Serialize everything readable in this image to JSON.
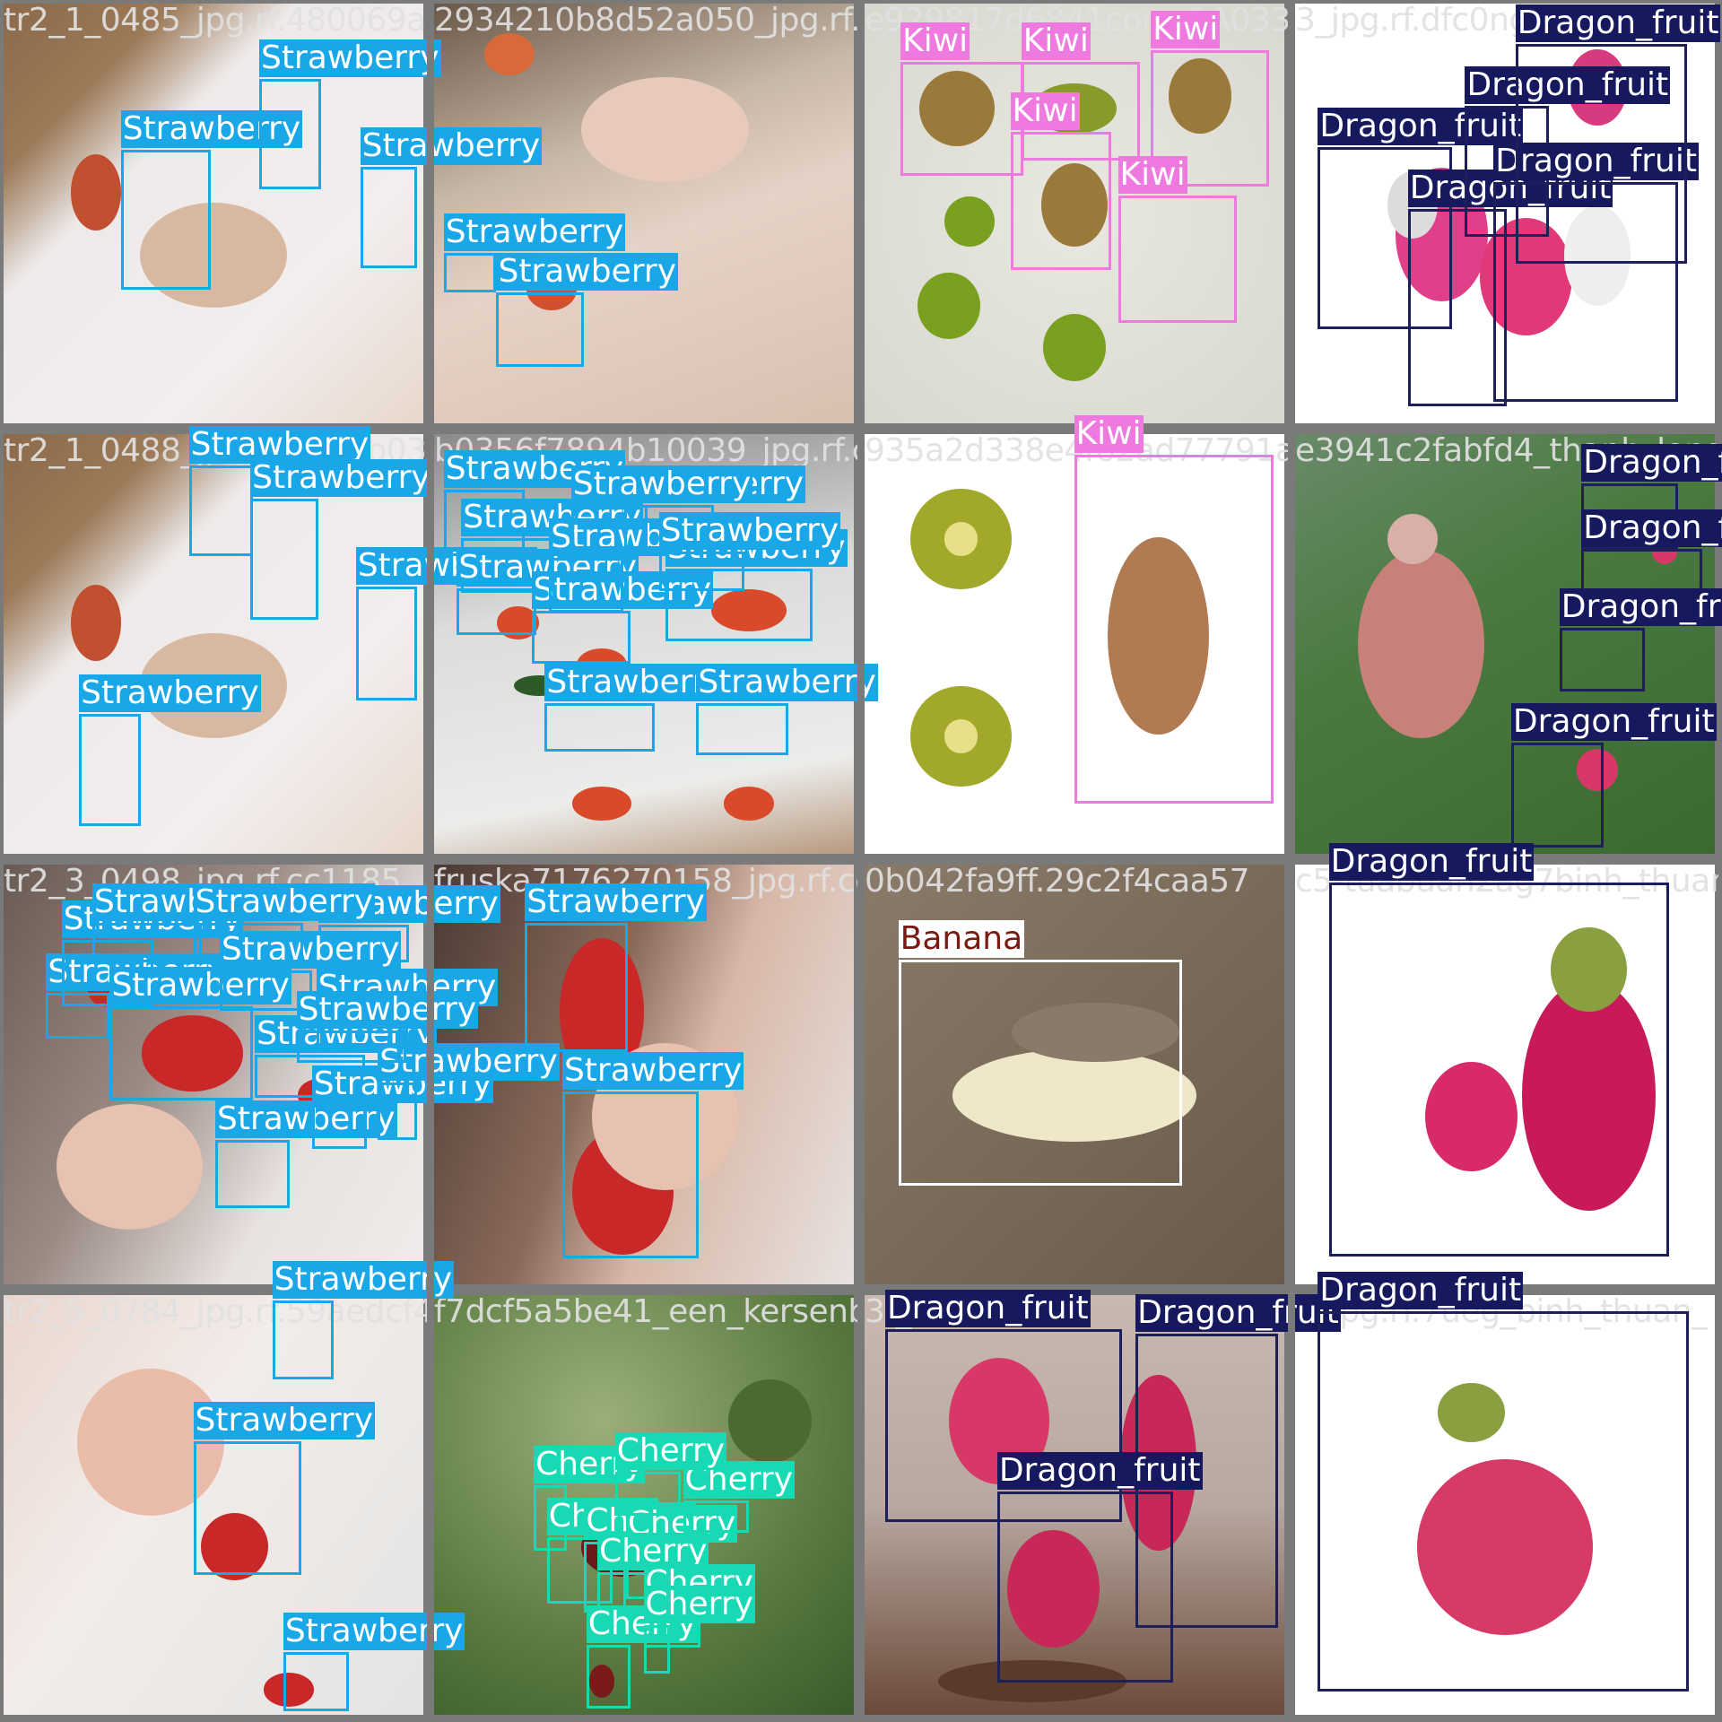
{
  "classes": {
    "Strawberry": {
      "border": "#1aa7e8",
      "bg": "#1aa7e8",
      "fg": "#ffffff"
    },
    "Kiwi": {
      "border": "#ee7ae0",
      "bg": "#ee7ae0",
      "fg": "#ffffff"
    },
    "Dragon_fruit": {
      "border": "#1c1f5a",
      "bg": "#16195e",
      "fg": "#ffffff"
    },
    "Banana": {
      "border": "#ffffff",
      "bg": "#ffffff",
      "fg": "#7a1a10"
    },
    "Cherry": {
      "border": "#17d9b4",
      "bg": "#17d9b4",
      "fg": "#ffffff"
    }
  },
  "tiles": [
    {
      "filename": "tr2_1_0485_jpg.rf.480069ac2954210b8d52a050_jpg.rf.1d4",
      "theme": "strawberry-hand",
      "detections": [
        {
          "cls": "Strawberry"
        },
        {
          "cls": "Strawberry"
        },
        {
          "cls": "Strawberry"
        }
      ]
    },
    {
      "filename": "2934210b8d52a050_jpg.rf.1d40e",
      "theme": "strawberry-hand2",
      "detections": [
        {
          "cls": "Strawberry"
        },
        {
          "cls": "Strawberry"
        },
        {
          "cls": "Strawberry"
        }
      ]
    },
    {
      "filename": "e929817d6841com_1A033-33_jpg.rf",
      "theme": "kiwi-pile",
      "detections": [
        {
          "cls": "Kiwi"
        },
        {
          "cls": "Kiwi"
        },
        {
          "cls": "Kiwi"
        },
        {
          "cls": "Kiwi"
        },
        {
          "cls": "Kiwi"
        }
      ]
    },
    {
      "filename": "3_jpg.rf.dfc0ng",
      "theme": "dragon-cut",
      "detections": [
        {
          "cls": "Dragon_fruit"
        },
        {
          "cls": "Dragon_fruit"
        },
        {
          "cls": "Dragon_fruit"
        },
        {
          "cls": "Dragon_fruit"
        },
        {
          "cls": "Dragon_fruit"
        }
      ]
    },
    {
      "filename": "tr2_1_0488_jpg.rf.d180b035f7894b1f0039_jpg.rf.ce",
      "theme": "strawberry-hand",
      "detections": [
        {
          "cls": "Strawberry"
        },
        {
          "cls": "Strawberry"
        },
        {
          "cls": "Strawberry"
        },
        {
          "cls": "Strawberry"
        }
      ]
    },
    {
      "filename": "b0356f7894b10039_jpg.rf.ce935",
      "theme": "strawberry-paper",
      "detections": [
        {
          "cls": "Strawberry"
        },
        {
          "cls": "Strawberry"
        },
        {
          "cls": "Strawberry"
        },
        {
          "cls": "Strawberry"
        },
        {
          "cls": "Strawberry"
        },
        {
          "cls": "Strawberry"
        },
        {
          "cls": "Strawberry"
        },
        {
          "cls": "Strawberry"
        },
        {
          "cls": "Strawberry"
        },
        {
          "cls": "Strawberry"
        },
        {
          "cls": "Strawberry"
        }
      ]
    },
    {
      "filename": "935a2d338e4f62ad77791a4e3941c2fabfd",
      "theme": "kiwi-cut",
      "detections": [
        {
          "cls": "Kiwi"
        }
      ]
    },
    {
      "filename": "e3941c2fabfd4_thanh_long",
      "theme": "dragon-farm",
      "detections": [
        {
          "cls": "Dragon_fruit"
        },
        {
          "cls": "Dragon_fruit"
        },
        {
          "cls": "Dragon_fruit"
        },
        {
          "cls": "Dragon_fruit"
        }
      ]
    },
    {
      "filename": "tr2_3_0498_jpg.rf.cc1185",
      "theme": "strawberry-many",
      "detections": [
        {
          "cls": "Strawberry"
        },
        {
          "cls": "Strawberry"
        },
        {
          "cls": "Strawberry"
        },
        {
          "cls": "Strawberry"
        },
        {
          "cls": "Strawberry"
        },
        {
          "cls": "Strawberry"
        },
        {
          "cls": "Strawberry"
        },
        {
          "cls": "Strawberry"
        },
        {
          "cls": "Strawberry"
        },
        {
          "cls": "Strawberry"
        },
        {
          "cls": "Strawberry"
        },
        {
          "cls": "Strawberry"
        },
        {
          "cls": "Strawberry"
        }
      ]
    },
    {
      "filename": "fruska7176270158_jpg.rf.cc1185",
      "theme": "strawberry-big",
      "detections": [
        {
          "cls": "Strawberry"
        },
        {
          "cls": "Strawberry"
        }
      ]
    },
    {
      "filename": "0b042fa9ff.29c2f4caa57",
      "theme": "banana",
      "detections": [
        {
          "cls": "Banana"
        }
      ]
    },
    {
      "filename": "c5-tuabuan2ag7binh_thuan_",
      "theme": "dragon-white",
      "detections": [
        {
          "cls": "Dragon_fruit"
        }
      ]
    },
    {
      "filename": "tr2_5_0784_jpg.rf.59aedcf49",
      "theme": "strawberry-hand3",
      "detections": [
        {
          "cls": "Strawberry"
        },
        {
          "cls": "Strawberry"
        },
        {
          "cls": "Strawberry"
        }
      ]
    },
    {
      "filename": "f7dcf5a5be41_een_kersenb",
      "theme": "cherry",
      "detections": [
        {
          "cls": "Cherry"
        },
        {
          "cls": "Cherry"
        },
        {
          "cls": "Cherry"
        },
        {
          "cls": "Cherry"
        },
        {
          "cls": "Cherry"
        },
        {
          "cls": "Cherry"
        },
        {
          "cls": "Cherry"
        },
        {
          "cls": "Cherry"
        },
        {
          "cls": "Cherry"
        },
        {
          "cls": "Cherry"
        }
      ]
    },
    {
      "filename": "3f_bi",
      "theme": "dragon-board",
      "detections": [
        {
          "cls": "Dragon_fruit"
        },
        {
          "cls": "Dragon_fruit"
        },
        {
          "cls": "Dragon_fruit"
        }
      ]
    },
    {
      "filename": "5_jpg.rf.7ueg_binh_thuan_",
      "theme": "dragon-white2",
      "detections": [
        {
          "cls": "Dragon_fruit"
        }
      ]
    }
  ]
}
